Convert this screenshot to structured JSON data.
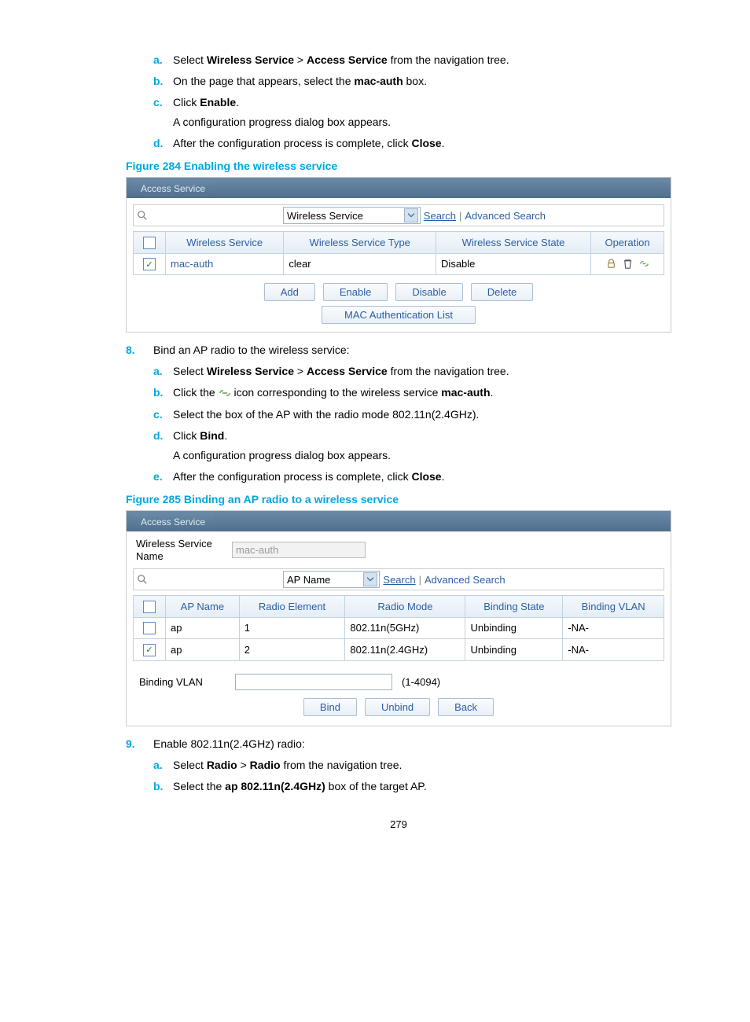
{
  "steps_top": [
    {
      "letter": "a.",
      "pre": "Select ",
      "b1": "Wireless Service",
      "mid": " > ",
      "b2": "Access Service",
      "post": " from the navigation tree."
    },
    {
      "letter": "b.",
      "pre": "On the page that appears, select the ",
      "b1": "mac-auth",
      "mid": "",
      "b2": "",
      "post": " box."
    },
    {
      "letter": "c.",
      "pre": "Click ",
      "b1": "Enable",
      "mid": "",
      "b2": "",
      "post": ".",
      "sub": "A configuration progress dialog box appears."
    },
    {
      "letter": "d.",
      "pre": "After the configuration process is complete, click ",
      "b1": "Close",
      "mid": "",
      "b2": "",
      "post": "."
    }
  ],
  "fig284_caption": "Figure 284 Enabling the wireless service",
  "fig284": {
    "tab": "Access Service",
    "select_label": "Wireless Service",
    "search_btn": "Search",
    "adv_search": "Advanced Search",
    "headers": [
      "",
      "Wireless Service",
      "Wireless Service Type",
      "Wireless Service State",
      "Operation"
    ],
    "row": {
      "checked": true,
      "name": "mac-auth",
      "type": "clear",
      "state": "Disable"
    },
    "buttons": [
      "Add",
      "Enable",
      "Disable",
      "Delete"
    ],
    "mac_list": "MAC Authentication List"
  },
  "step8": {
    "num": "8.",
    "text": "Bind an AP radio to the wireless service:"
  },
  "steps_8": [
    {
      "letter": "a.",
      "pre": "Select ",
      "b1": "Wireless Service",
      "mid": " > ",
      "b2": "Access Service",
      "post": " from the navigation tree."
    },
    {
      "letter": "b.",
      "pre": "Click the ",
      "icon": true,
      "post_icon": " icon corresponding to the wireless service ",
      "b1": "mac-auth",
      "post": "."
    },
    {
      "letter": "c.",
      "text": "Select the box of the AP with the radio mode 802.11n(2.4GHz)."
    },
    {
      "letter": "d.",
      "pre": "Click ",
      "b1": "Bind",
      "post": ".",
      "sub": "A configuration progress dialog box appears."
    },
    {
      "letter": "e.",
      "pre": "After the configuration process is complete, click ",
      "b1": "Close",
      "post": "."
    }
  ],
  "fig285_caption": "Figure 285 Binding an AP radio to a wireless service",
  "fig285": {
    "tab": "Access Service",
    "ws_label": "Wireless Service Name",
    "ws_value": "mac-auth",
    "select_label": "AP Name",
    "search_btn": "Search",
    "adv_search": "Advanced Search",
    "headers": [
      "",
      "AP Name",
      "Radio Element",
      "Radio Mode",
      "Binding State",
      "Binding VLAN"
    ],
    "rows": [
      {
        "checked": false,
        "ap": "ap",
        "re": "1",
        "rm": "802.11n(5GHz)",
        "bs": "Unbinding",
        "bv": "-NA-"
      },
      {
        "checked": true,
        "ap": "ap",
        "re": "2",
        "rm": "802.11n(2.4GHz)",
        "bs": "Unbinding",
        "bv": "-NA-"
      }
    ],
    "bvlan_label": "Binding VLAN",
    "bvlan_hint": "(1-4094)",
    "buttons": [
      "Bind",
      "Unbind",
      "Back"
    ]
  },
  "step9": {
    "num": "9.",
    "text": "Enable 802.11n(2.4GHz) radio:"
  },
  "steps_9": [
    {
      "letter": "a.",
      "pre": "Select ",
      "b1": "Radio",
      "mid": " > ",
      "b2": "Radio",
      "post": " from the navigation tree."
    },
    {
      "letter": "b.",
      "pre": "Select the ",
      "b1": "ap 802.11n(2.4GHz)",
      "post": " box of the target AP."
    }
  ],
  "page_number": "279"
}
